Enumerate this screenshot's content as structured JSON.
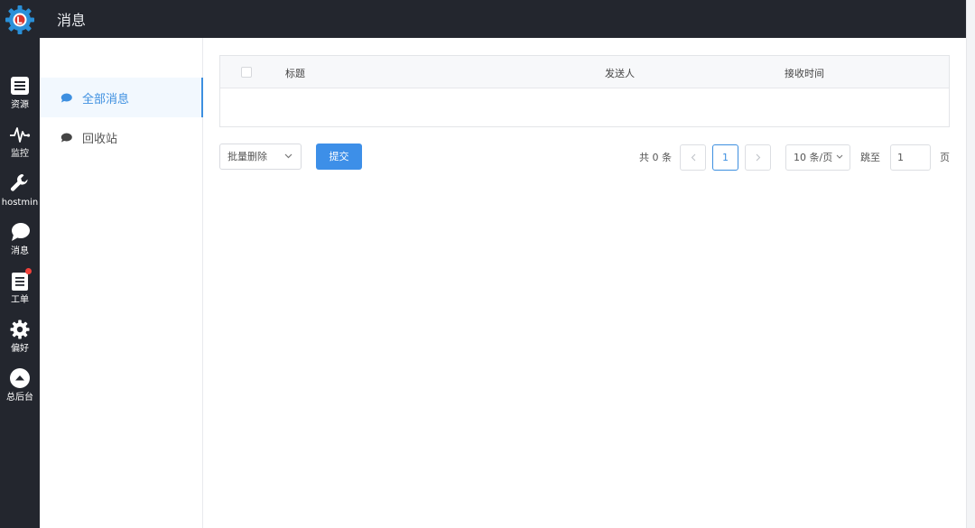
{
  "header": {
    "title": "消息"
  },
  "rail": {
    "items": [
      {
        "label": "资源",
        "icon": "resources-icon"
      },
      {
        "label": "监控",
        "icon": "monitor-pulse-icon"
      },
      {
        "label": "hostmin",
        "icon": "wrench-icon"
      },
      {
        "label": "消息",
        "icon": "chat-bubble-icon"
      },
      {
        "label": "工单",
        "icon": "clipboard-icon",
        "badge": true
      },
      {
        "label": "偏好",
        "icon": "gear-icon"
      },
      {
        "label": "总后台",
        "icon": "up-arrow-circle-icon"
      }
    ]
  },
  "subnav": {
    "items": [
      {
        "label": "全部消息",
        "active": true
      },
      {
        "label": "回收站",
        "active": false
      }
    ]
  },
  "table": {
    "columns": [
      "标题",
      "发送人",
      "接收时间"
    ],
    "rows": []
  },
  "toolbar": {
    "batch_select": "批量删除",
    "submit_label": "提交"
  },
  "pagination": {
    "total": "共 0 条",
    "current_page": "1",
    "page_size": "10 条/页",
    "jump_label": "跳至",
    "jump_value": "1",
    "page_suffix": "页"
  },
  "colors": {
    "rail_bg": "#23262e",
    "accent": "#3d8fe8",
    "badge": "#f0413b"
  }
}
